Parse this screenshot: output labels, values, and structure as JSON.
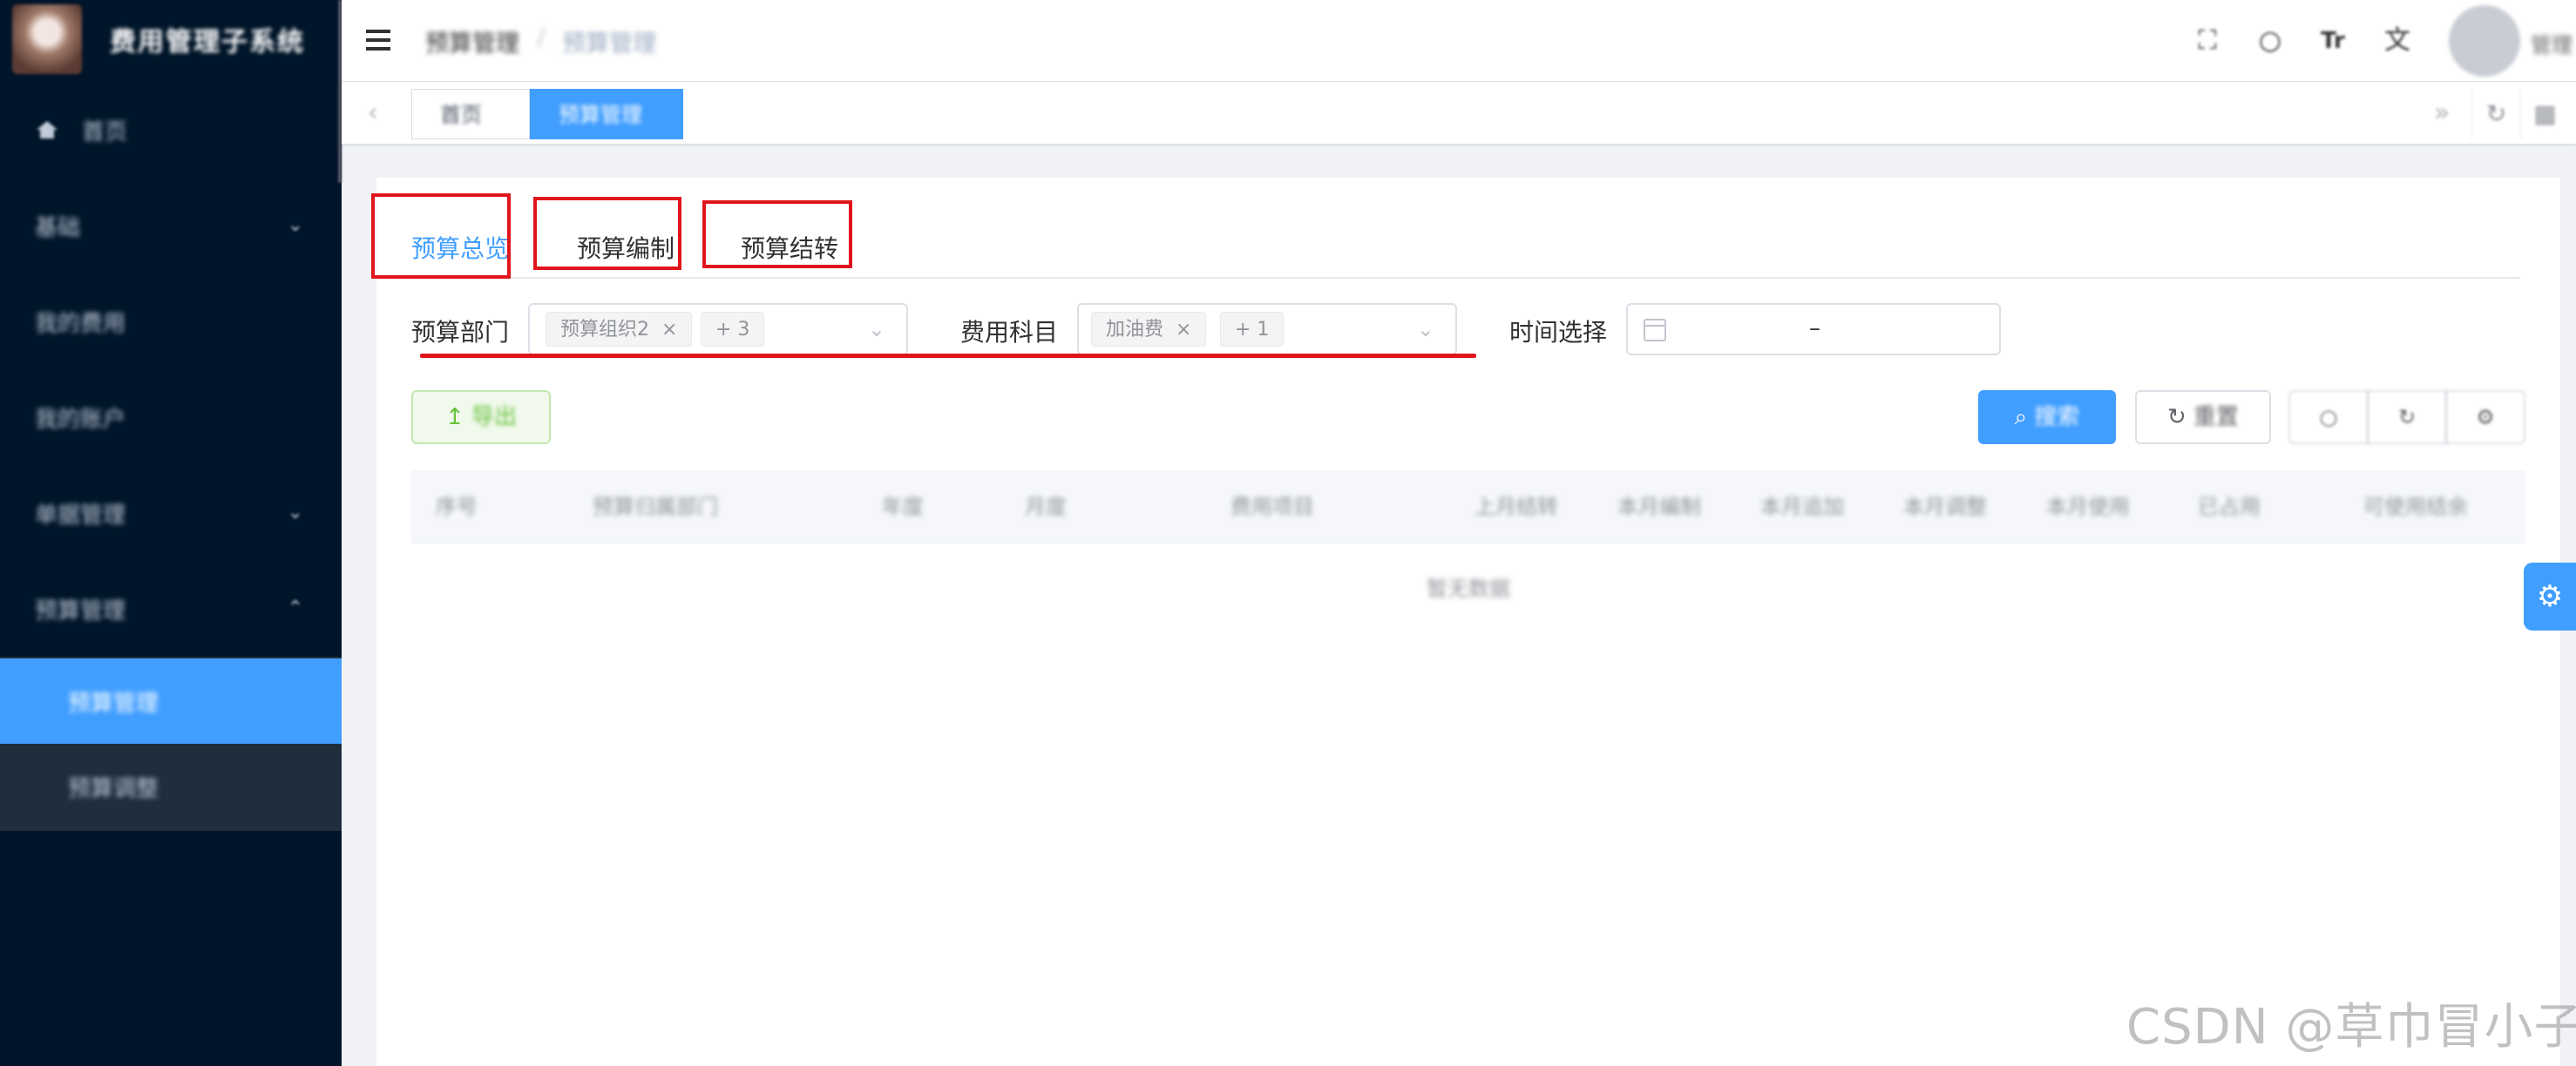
{
  "sidebar": {
    "title": "费用管理子系统",
    "items": [
      {
        "label": "首页",
        "chevron": ""
      },
      {
        "label": "基础",
        "chevron": "⌄"
      },
      {
        "label": "我的费用",
        "chevron": ""
      },
      {
        "label": "我的账户",
        "chevron": ""
      },
      {
        "label": "单据管理",
        "chevron": "⌄"
      },
      {
        "label": "预算管理",
        "chevron": "⌃"
      },
      {
        "label": "预算管理",
        "chevron": ""
      },
      {
        "label": "预算调整",
        "chevron": ""
      }
    ]
  },
  "header": {
    "breadcrumb": [
      "预算管理",
      "预算管理"
    ],
    "username": "管理"
  },
  "tags": {
    "items": [
      "首页",
      "预算管理"
    ]
  },
  "tabs": [
    "预算总览",
    "预算编制",
    "预算结转"
  ],
  "filters": {
    "dept_label": "预算部门",
    "dept_chip": "预算组织2",
    "dept_more": "+ 3",
    "subject_label": "费用科目",
    "subject_chip": "加油费",
    "subject_more": "+ 1",
    "time_label": "时间选择",
    "date_separator": "–"
  },
  "buttons": {
    "export": "导出",
    "search": "搜索",
    "reset": "重置"
  },
  "table": {
    "columns": [
      "序号",
      "预算归属部门",
      "年度",
      "月度",
      "费用项目",
      "上月结转",
      "本月编制",
      "本月追加",
      "本月调整",
      "本月使用",
      "已占用",
      "可使用结余"
    ],
    "empty_text": "暂无数据"
  },
  "watermark": "CSDN @草巾冒小子",
  "colors": {
    "sidebar_bg": "#001529",
    "accent": "#409eff",
    "annotation_red": "#e0151c"
  }
}
